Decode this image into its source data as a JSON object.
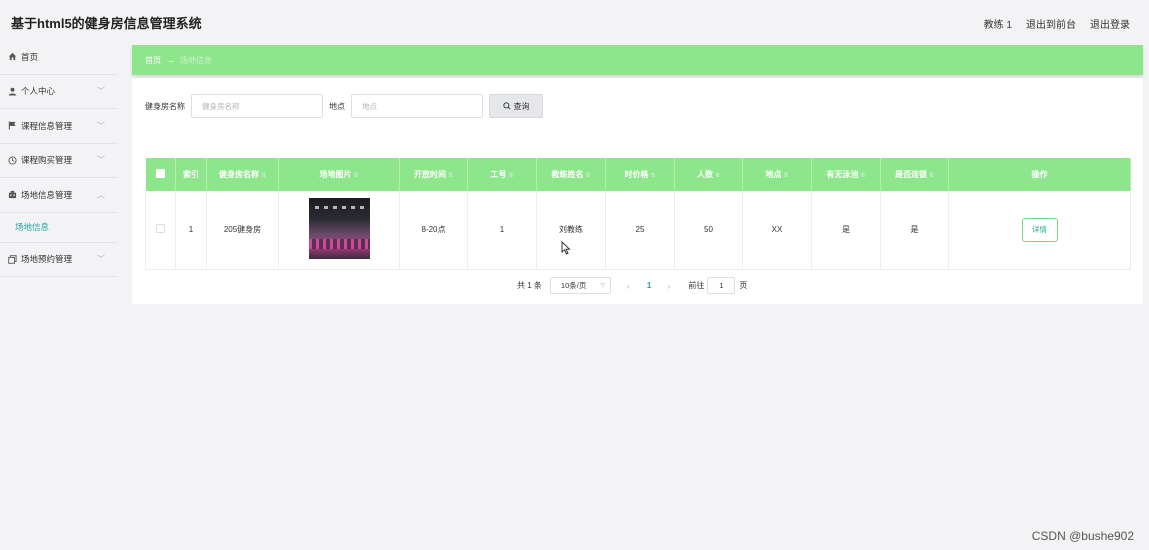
{
  "app": {
    "title": "基于html5的健身房信息管理系统"
  },
  "header": {
    "user": "教练 1",
    "to_front": "退出到前台",
    "logout": "退出登录"
  },
  "sidebar": {
    "items": [
      {
        "label": "首页",
        "icon": "home-icon"
      },
      {
        "label": "个人中心",
        "icon": "user-icon"
      },
      {
        "label": "课程信息管理",
        "icon": "flag-icon"
      },
      {
        "label": "课程购买管理",
        "icon": "clock-icon"
      },
      {
        "label": "场地信息管理",
        "icon": "building-icon"
      },
      {
        "label": "场地预约管理",
        "icon": "copy-icon"
      }
    ],
    "sub_item": "场地信息"
  },
  "breadcrumb": {
    "home": "首页",
    "separator": "→",
    "current": "场地信息"
  },
  "search": {
    "name_label": "健身房名称",
    "name_placeholder": "健身房名称",
    "place_label": "地点",
    "place_placeholder": "地点",
    "button": "查询"
  },
  "table": {
    "headers": [
      "索引",
      "健身房名称",
      "场地图片",
      "开放时间",
      "工号",
      "教练姓名",
      "时价格",
      "人数",
      "地点",
      "有无泳池",
      "是否连锁",
      "操作"
    ],
    "rows": [
      {
        "index": "1",
        "name": "205健身房",
        "open_time": "8-20点",
        "job_no": "1",
        "coach": "刘教练",
        "price": "25",
        "people": "50",
        "place": "XX",
        "pool": "是",
        "chain": "是",
        "action": "详情"
      }
    ]
  },
  "pagination": {
    "total": "共 1 条",
    "page_size": "10条/页",
    "current_page": "1",
    "goto": "前往",
    "goto_value": "1",
    "page_unit": "页"
  },
  "watermark": "CSDN @bushe902",
  "colors": {
    "accent": "#8ee68c",
    "teal": "#25a5a0"
  }
}
